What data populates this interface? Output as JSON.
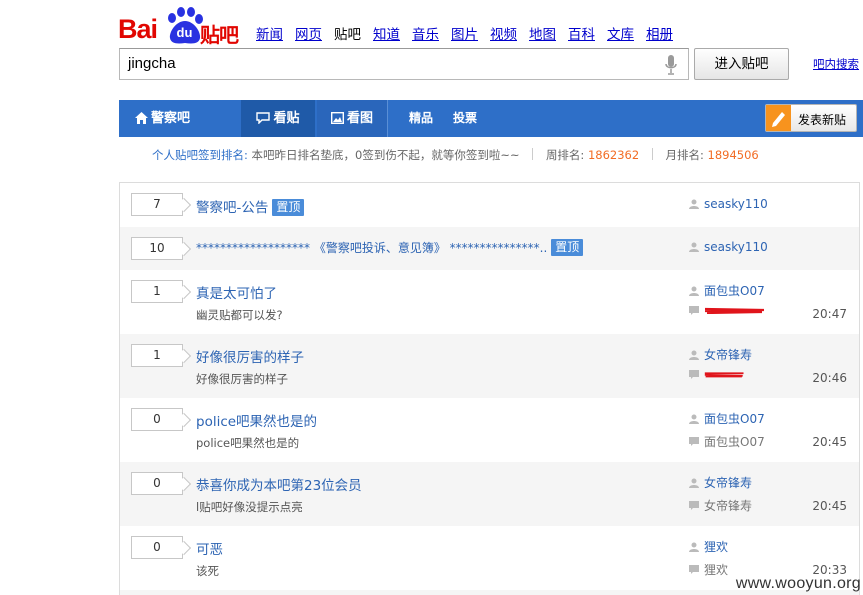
{
  "logo": {
    "text_bai": "Bai",
    "text_du": "du",
    "text_tieba": "贴吧"
  },
  "topnav": [
    "新闻",
    "网页",
    "贴吧",
    "知道",
    "音乐",
    "图片",
    "视频",
    "地图",
    "百科",
    "文库",
    "相册"
  ],
  "search": {
    "value": "jingcha",
    "enter_label": "进入贴吧",
    "inner_search_label": "吧内搜索"
  },
  "navbar": {
    "forum_name": "警察吧",
    "tab_posts": "看贴",
    "tab_pics": "看图",
    "tab_good": "精品",
    "tab_vote": "投票",
    "post_button": "发表新贴"
  },
  "rank": {
    "label": "个人贴吧签到排名:",
    "message": "本吧昨日排名垫底，0签到伤不起，就等你签到啦~~",
    "week_label": "周排名:",
    "week_value": "1862362",
    "month_label": "月排名:",
    "month_value": "1894506"
  },
  "threads": [
    {
      "replies": "7",
      "title": "警察吧-公告",
      "tag": "置顶",
      "abstract": "",
      "author": "seasky110",
      "last_replier": "",
      "time": ""
    },
    {
      "replies": "10",
      "title": "******************* 《警察吧投诉、意见簿》 ***************..",
      "tag": "置顶",
      "abstract": "",
      "author": "seasky110",
      "last_replier": "",
      "time": ""
    },
    {
      "replies": "1",
      "title": "真是太可怕了",
      "tag": "",
      "abstract": "幽灵贴都可以发?",
      "author": "面包虫O07",
      "last_replier": "",
      "time": "20:47"
    },
    {
      "replies": "1",
      "title": "好像很厉害的样子",
      "tag": "",
      "abstract": "好像很厉害的样子",
      "author": "女帝锋寿",
      "last_replier": "",
      "time": "20:46"
    },
    {
      "replies": "0",
      "title": "police吧果然也是的",
      "tag": "",
      "abstract": "police吧果然也是的",
      "author": "面包虫O07",
      "last_replier": "面包虫O07",
      "time": "20:45"
    },
    {
      "replies": "0",
      "title": "恭喜你成为本吧第23位会员",
      "tag": "",
      "abstract": "l贴吧好像没提示点亮",
      "author": "女帝锋寿",
      "last_replier": "女帝锋寿",
      "time": "20:45"
    },
    {
      "replies": "0",
      "title": "可恶",
      "tag": "",
      "abstract": "该死",
      "author": "狸欢",
      "last_replier": "狸欢",
      "time": "20:33"
    }
  ],
  "watermark": "www.wooyun.org",
  "colors": {
    "brand_red": "#e10601",
    "nav_blue": "#2e6fc8",
    "link_blue": "#2d64b3",
    "rank_orange": "#f26c24"
  }
}
